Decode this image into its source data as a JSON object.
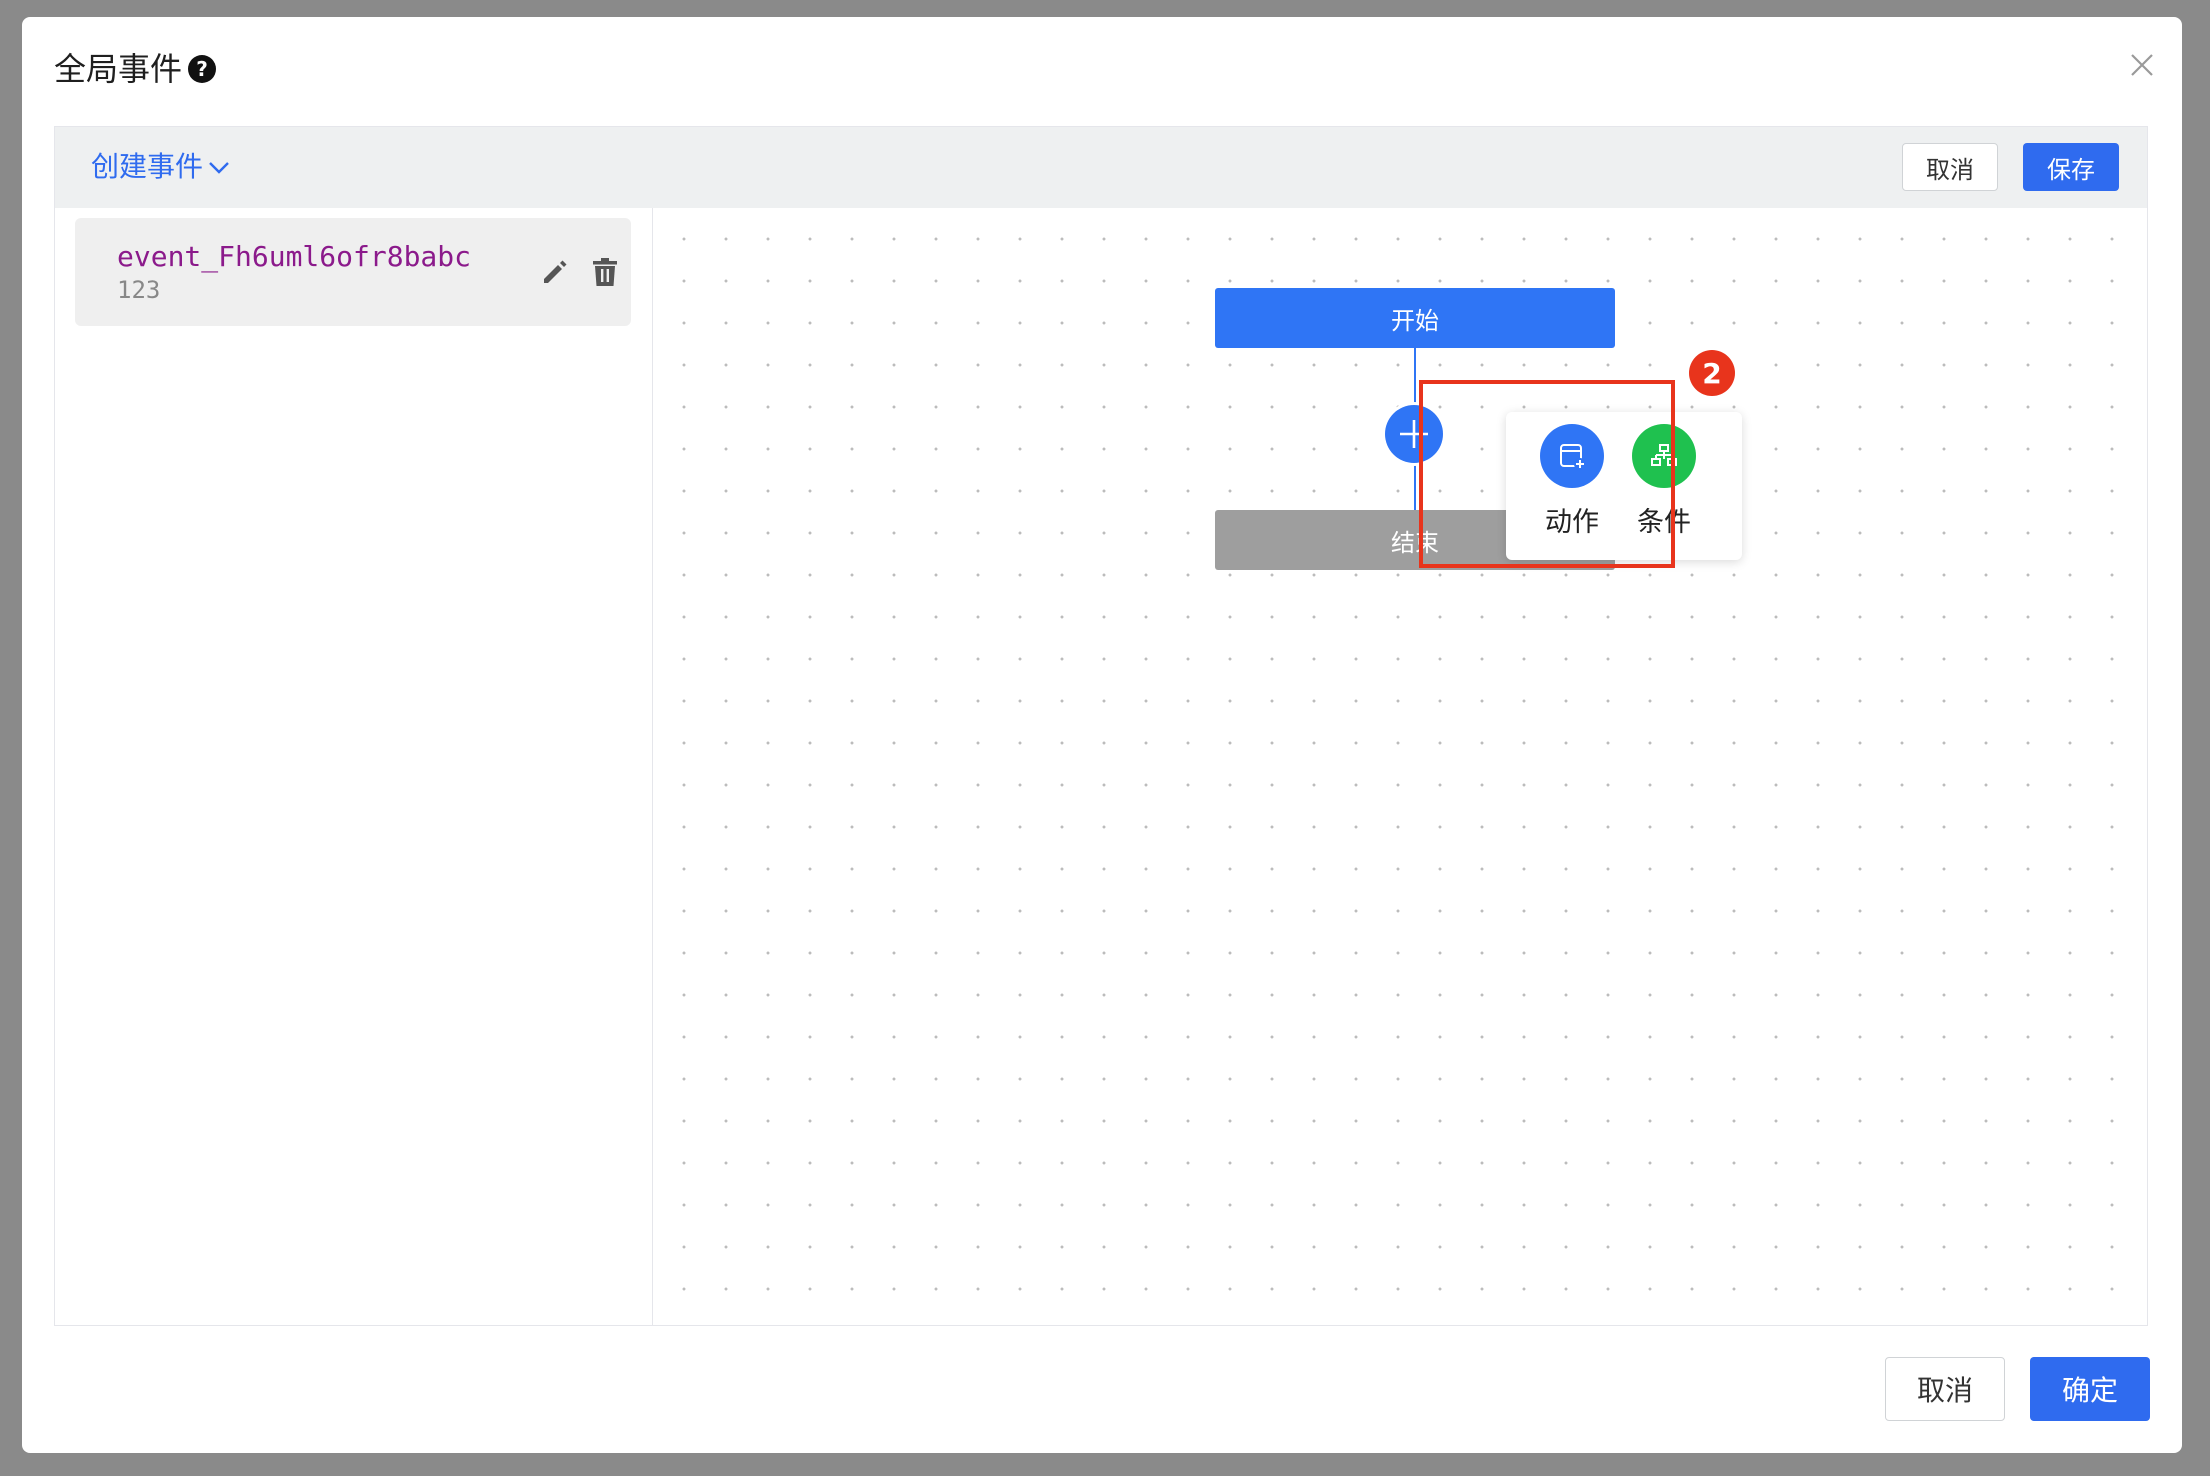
{
  "dialog": {
    "title": "全局事件",
    "help_icon": "?",
    "close_icon": "×"
  },
  "toolbar": {
    "create_event_label": "创建事件",
    "cancel_label": "取消",
    "save_label": "保存"
  },
  "event_list": [
    {
      "name": "event_Fh6uml6ofr8babc",
      "description": "123",
      "icons": [
        "edit-icon",
        "trash-icon"
      ]
    }
  ],
  "flow": {
    "start_label": "开始",
    "end_label": "结束",
    "add_icon": "plus-icon"
  },
  "popover": {
    "action_label": "动作",
    "condition_label": "条件"
  },
  "annotation": {
    "step_number": "2",
    "color": "#e8341c"
  },
  "footer": {
    "cancel_label": "取消",
    "confirm_label": "确定"
  },
  "colors": {
    "primary": "#2f6bef",
    "condition_green": "#1fc14f",
    "end_node_gray": "#9e9e9e",
    "event_name_purple": "#8b1a8b"
  }
}
